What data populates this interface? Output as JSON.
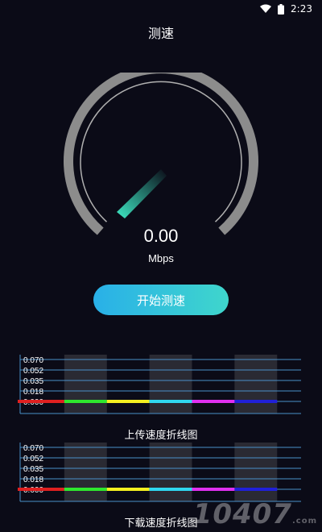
{
  "status_bar": {
    "time": "2:23",
    "icons": [
      "wifi-icon",
      "battery-icon"
    ]
  },
  "header": {
    "title": "测速"
  },
  "gauge": {
    "value": "0.00",
    "unit": "Mbps",
    "needle_fraction": 0.0,
    "colors": {
      "track": "#8c8c8c",
      "needle": "#3ee8c4"
    }
  },
  "actions": {
    "start_label": "开始测速"
  },
  "charts": [
    {
      "id": "upload",
      "label": "上传速度折线图",
      "y_ticks": [
        "0.070",
        "0.052",
        "0.035",
        "0.018",
        "0.000"
      ],
      "band_colors": [
        "#e02020",
        "#2ee82e",
        "#f5f020",
        "#30d8f0",
        "#e030f0",
        "#2020d8"
      ]
    },
    {
      "id": "download",
      "label": "下载速度折线图",
      "y_ticks": [
        "0.070",
        "0.052",
        "0.035",
        "0.018",
        "0.000"
      ],
      "band_colors": [
        "#e02020",
        "#2ee82e",
        "#f5f020",
        "#30d8f0",
        "#e030f0",
        "#2020d8"
      ]
    }
  ],
  "watermark": {
    "text": "10407",
    "suffix": ".com"
  }
}
